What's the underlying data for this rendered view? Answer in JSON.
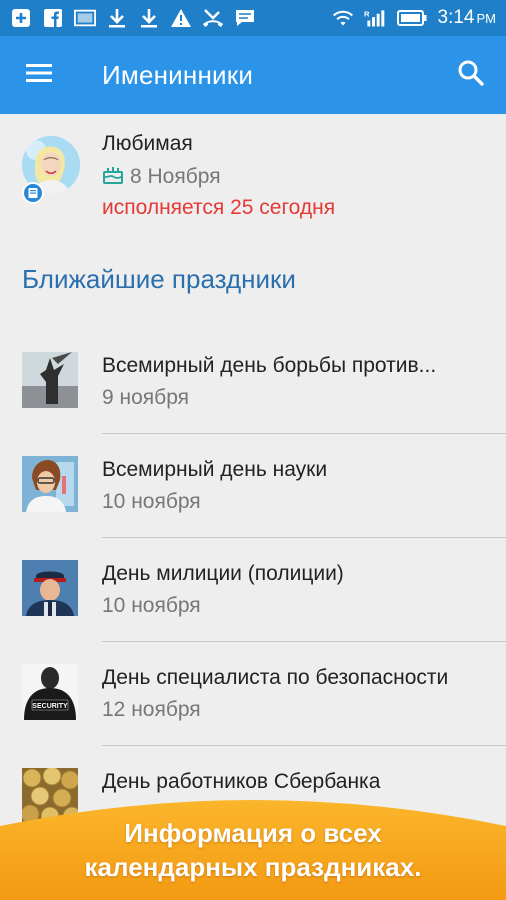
{
  "status_bar": {
    "time": "3:14",
    "ampm": "PM",
    "colors": {
      "background": "#1f7fc8"
    },
    "icons_left": [
      "add-box-icon",
      "facebook-icon",
      "image-icon",
      "download-icon",
      "download-icon",
      "warning-icon",
      "missed-call-icon",
      "chat-icon"
    ],
    "icons_right": [
      "wifi-icon",
      "signal-icon",
      "battery-icon"
    ]
  },
  "app_bar": {
    "title": "Именинники",
    "color": "#2b93e8",
    "menu_icon": "hamburger-menu-icon",
    "search_icon": "search-icon"
  },
  "birthday": {
    "name": "Любимая",
    "date": "8 Ноября",
    "note": "исполняется 25 сегодня",
    "note_color": "#e53935",
    "badge_icon": "contact-book-icon",
    "date_icon": "cake-icon"
  },
  "section_title": "Ближайшие праздники",
  "holidays": [
    {
      "title": "Всемирный день борьбы против...",
      "date": "9 ноября",
      "thumb": "monument-photo"
    },
    {
      "title": "Всемирный день науки",
      "date": "10 ноября",
      "thumb": "scientist-photo"
    },
    {
      "title": "День милиции (полиции)",
      "date": "10 ноября",
      "thumb": "police-officer-photo"
    },
    {
      "title": "День специалиста по безопасности",
      "date": "12 ноября",
      "thumb": "security-guard-photo",
      "badge_text": "SECURITY"
    },
    {
      "title": "День работников Сбербанка",
      "date": "",
      "thumb": "coins-photo"
    }
  ],
  "promo": {
    "line1": "Информация о всех",
    "line2": "календарных праздниках.",
    "color": "#f5a21b"
  }
}
